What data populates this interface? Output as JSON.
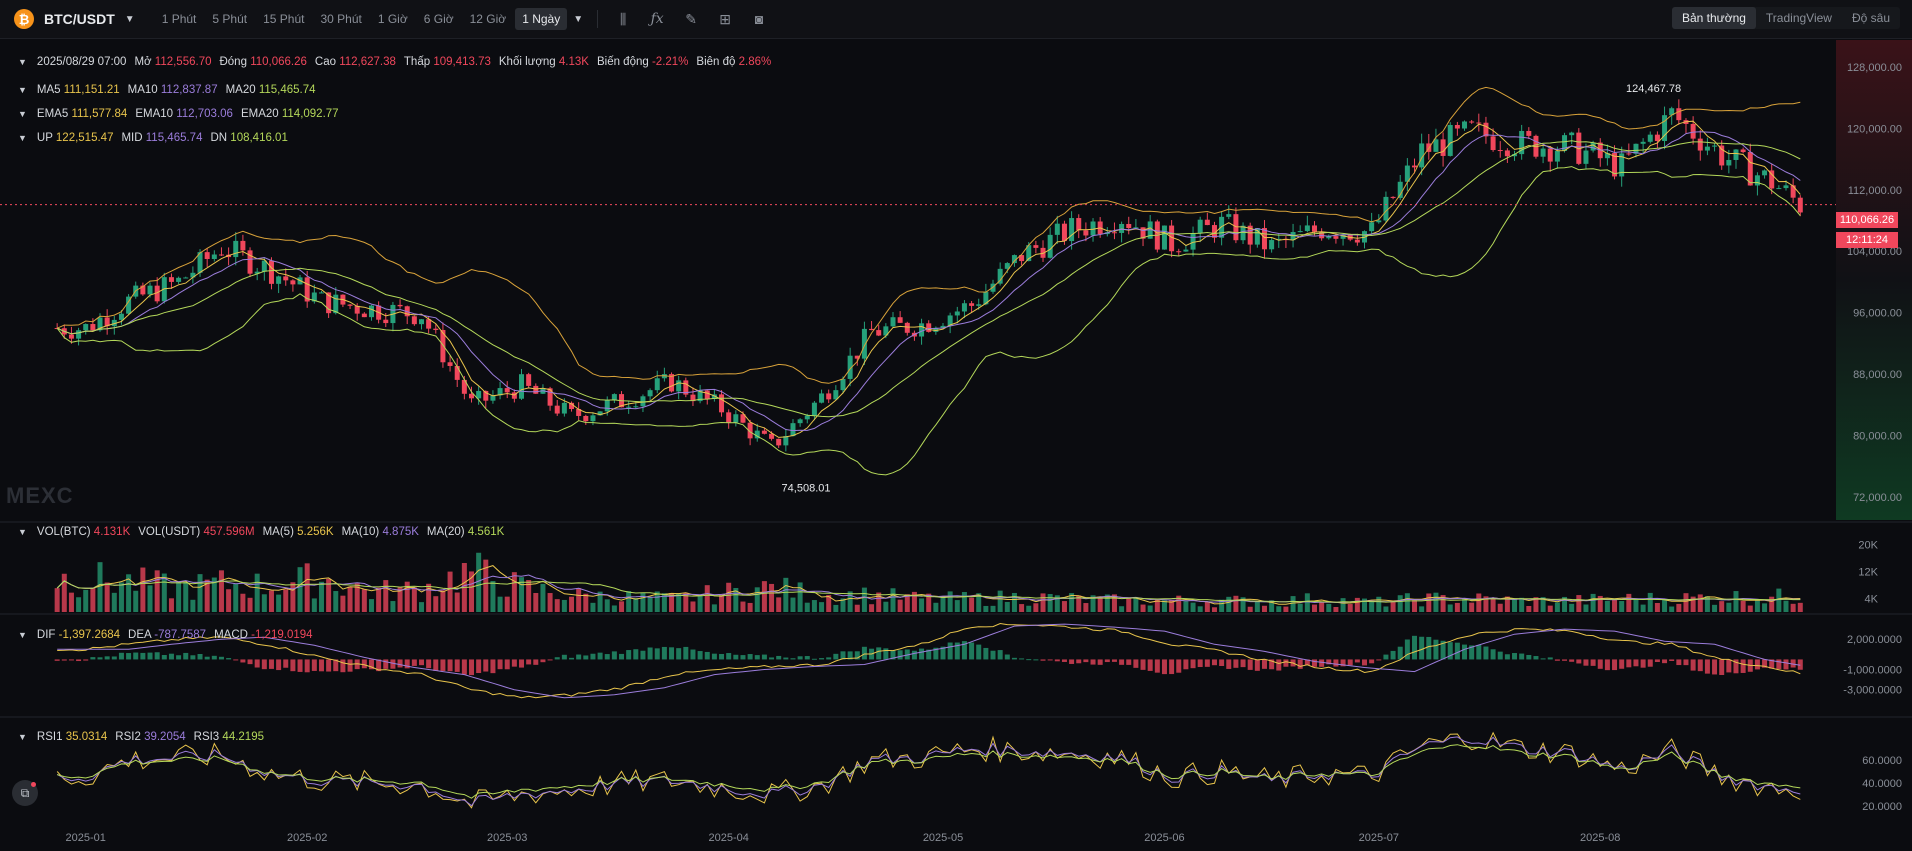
{
  "topbar": {
    "pair": "BTC/USDT",
    "intervals": [
      "1 Phút",
      "5 Phút",
      "15 Phút",
      "30 Phút",
      "1 Giờ",
      "6 Giờ",
      "12 Giờ",
      "1 Ngày"
    ],
    "active_interval": "1 Ngày",
    "tools": [
      "candle-type-icon",
      "indicator-fx-icon",
      "draw-pencil-icon",
      "layout-grid-icon",
      "camera-icon"
    ],
    "views": [
      "Bản thường",
      "TradingView",
      "Độ sâu"
    ],
    "active_view": "Bản thường"
  },
  "ohlc": {
    "date": "2025/08/29 07:00",
    "open_label": "Mở",
    "open": "112,556.70",
    "close_label": "Đóng",
    "close": "110,066.26",
    "high_label": "Cao",
    "high": "112,627.38",
    "low_label": "Thấp",
    "low": "109,413.73",
    "vol_label": "Khối lượng",
    "vol": "4.13K",
    "change_label": "Biến động",
    "change": "-2.21%",
    "amp_label": "Biên độ",
    "amp": "2.86%"
  },
  "ma": {
    "ma5_label": "MA5",
    "ma5": "111,151.21",
    "ma10_label": "MA10",
    "ma10": "112,837.87",
    "ma20_label": "MA20",
    "ma20": "115,465.74"
  },
  "ema": {
    "ema5_label": "EMA5",
    "ema5": "111,577.84",
    "ema10_label": "EMA10",
    "ema10": "112,703.06",
    "ema20_label": "EMA20",
    "ema20": "114,092.77"
  },
  "boll": {
    "up_label": "UP",
    "up": "122,515.47",
    "mid_label": "MID",
    "mid": "115,465.74",
    "dn_label": "DN",
    "dn": "108,416.01"
  },
  "vol": {
    "btc_label": "VOL(BTC)",
    "btc": "4.131K",
    "usdt_label": "VOL(USDT)",
    "usdt": "457.596M",
    "ma5_label": "MA(5)",
    "ma5": "5.256K",
    "ma10_label": "MA(10)",
    "ma10": "4.875K",
    "ma20_label": "MA(20)",
    "ma20": "4.561K"
  },
  "macd": {
    "dif_label": "DIF",
    "dif": "-1,397.2684",
    "dea_label": "DEA",
    "dea": "-787.7587",
    "macd_label": "MACD",
    "macd": "-1,219.0194"
  },
  "rsi": {
    "rsi1_label": "RSI1",
    "rsi1": "35.0314",
    "rsi2_label": "RSI2",
    "rsi2": "39.2054",
    "rsi3_label": "RSI3",
    "rsi3": "44.2195"
  },
  "current_price": "110,066.26",
  "countdown": "12:11:24",
  "watermark": "MEXC",
  "colors": {
    "up": "#26a17b",
    "down": "#f0475c",
    "ma5": "#e8c44c",
    "ma10": "#9b7ddb",
    "ma20": "#b4d85a",
    "background": "#0b0c10"
  },
  "chart_data": {
    "type": "candlestick",
    "title": "",
    "xlabel": "",
    "ylabel": "",
    "x_ticks": [
      "2025-01",
      "2025-02",
      "2025-03",
      "2025-04",
      "2025-05",
      "2025-06",
      "2025-07",
      "2025-08"
    ],
    "price_ticks": [
      "128,000.00",
      "120,000.00",
      "112,000.00",
      "104,000.00",
      "96,000.00",
      "88,000.00",
      "80,000.00",
      "72,000.00"
    ],
    "price_ylim": [
      69000,
      131500
    ],
    "high_marker": "124,467.78",
    "low_marker": "74,508.01",
    "volume_ticks": [
      "20K",
      "12K",
      "4K"
    ],
    "volume_ylim": [
      0,
      26000
    ],
    "macd_ticks": [
      "2,000.0000",
      "-1,000.0000",
      "-3,000.0000"
    ],
    "macd_ylim": [
      -5500,
      4200
    ],
    "rsi_ticks": [
      "60.0000",
      "40.0000",
      "20.0000"
    ],
    "rsi_ylim": [
      5,
      95
    ],
    "close_series": {
      "dates": [
        "2025-01-01",
        "2025-01-07",
        "2025-01-14",
        "2025-01-20",
        "2025-01-27",
        "2025-02-03",
        "2025-02-10",
        "2025-02-17",
        "2025-02-24",
        "2025-03-03",
        "2025-03-10",
        "2025-03-17",
        "2025-03-24",
        "2025-03-31",
        "2025-04-07",
        "2025-04-14",
        "2025-04-21",
        "2025-04-28",
        "2025-05-05",
        "2025-05-12",
        "2025-05-19",
        "2025-05-26",
        "2025-06-02",
        "2025-06-09",
        "2025-06-16",
        "2025-06-23",
        "2025-06-30",
        "2025-07-07",
        "2025-07-14",
        "2025-07-21",
        "2025-07-28",
        "2025-08-04",
        "2025-08-11",
        "2025-08-18",
        "2025-08-25",
        "2025-08-29"
      ],
      "values": [
        94000,
        97500,
        100000,
        104500,
        101500,
        97500,
        96500,
        95800,
        84000,
        86500,
        82500,
        84500,
        87000,
        83500,
        78500,
        85000,
        93500,
        94500,
        97000,
        103500,
        106800,
        108500,
        105000,
        107500,
        104500,
        107000,
        106500,
        117000,
        119500,
        118000,
        117500,
        115000,
        121800,
        116500,
        113000,
        110066
      ]
    },
    "volume_avg": [
      9000,
      8000,
      6500,
      7500,
      7000,
      9000,
      5500,
      6000,
      11000,
      6500,
      4500,
      4000,
      3500,
      5000,
      6500,
      4500,
      4500,
      3500,
      3500,
      4000,
      3500,
      3000,
      3000,
      3000,
      2800,
      3500,
      2500,
      3500,
      3500,
      3000,
      3000,
      3500,
      3500,
      4000,
      4000,
      4131
    ],
    "macd_series": [
      1000,
      1500,
      2000,
      2200,
      1400,
      200,
      -800,
      -1500,
      -3000,
      -3800,
      -3500,
      -2800,
      -1500,
      -1000,
      -700,
      -500,
      600,
      1500,
      3300,
      3500,
      3200,
      2800,
      1500,
      800,
      -200,
      -800,
      -1200,
      1000,
      2500,
      3000,
      2800,
      1800,
      1500,
      0,
      -800,
      -1397
    ],
    "rsi_series": [
      45,
      60,
      62,
      64,
      48,
      42,
      40,
      38,
      22,
      30,
      34,
      40,
      42,
      36,
      30,
      38,
      60,
      62,
      70,
      68,
      66,
      62,
      45,
      50,
      42,
      48,
      46,
      72,
      80,
      70,
      66,
      52,
      68,
      46,
      36,
      35
    ]
  }
}
